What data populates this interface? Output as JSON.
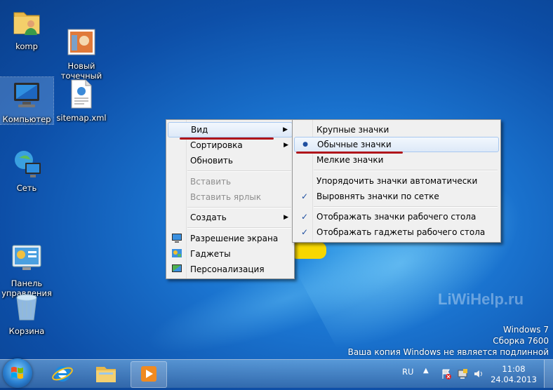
{
  "desktop": {
    "icons": [
      {
        "label": "komp"
      },
      {
        "label": "Новый\nточечный р..."
      },
      {
        "label": "Компьютер"
      },
      {
        "label": "sitemap.xml"
      },
      {
        "label": "Сеть"
      },
      {
        "label": "Панель\nуправления"
      },
      {
        "label": "Корзина"
      }
    ]
  },
  "context_menu": {
    "items": [
      {
        "label": "Вид"
      },
      {
        "label": "Сортировка"
      },
      {
        "label": "Обновить"
      },
      {
        "label": "Вставить"
      },
      {
        "label": "Вставить ярлык"
      },
      {
        "label": "Создать"
      },
      {
        "label": "Разрешение экрана"
      },
      {
        "label": "Гаджеты"
      },
      {
        "label": "Персонализация"
      }
    ]
  },
  "submenu": {
    "items": [
      {
        "label": "Крупные значки"
      },
      {
        "label": "Обычные значки"
      },
      {
        "label": "Мелкие значки"
      },
      {
        "label": "Упорядочить значки автоматически"
      },
      {
        "label": "Выровнять значки по сетке"
      },
      {
        "label": "Отображать значки рабочего стола"
      },
      {
        "label": "Отображать гаджеты  рабочего стола"
      }
    ],
    "radio_mark": "●",
    "check_mark": "✓"
  },
  "watermark": {
    "line1": "Windows 7",
    "line2": "Сборка 7600",
    "line3": "Ваша копия Windows не является подлинной"
  },
  "brand": "LiWiHelp.ru",
  "taskbar": {
    "language": "RU",
    "time": "11:08",
    "date": "24.04.2013"
  }
}
